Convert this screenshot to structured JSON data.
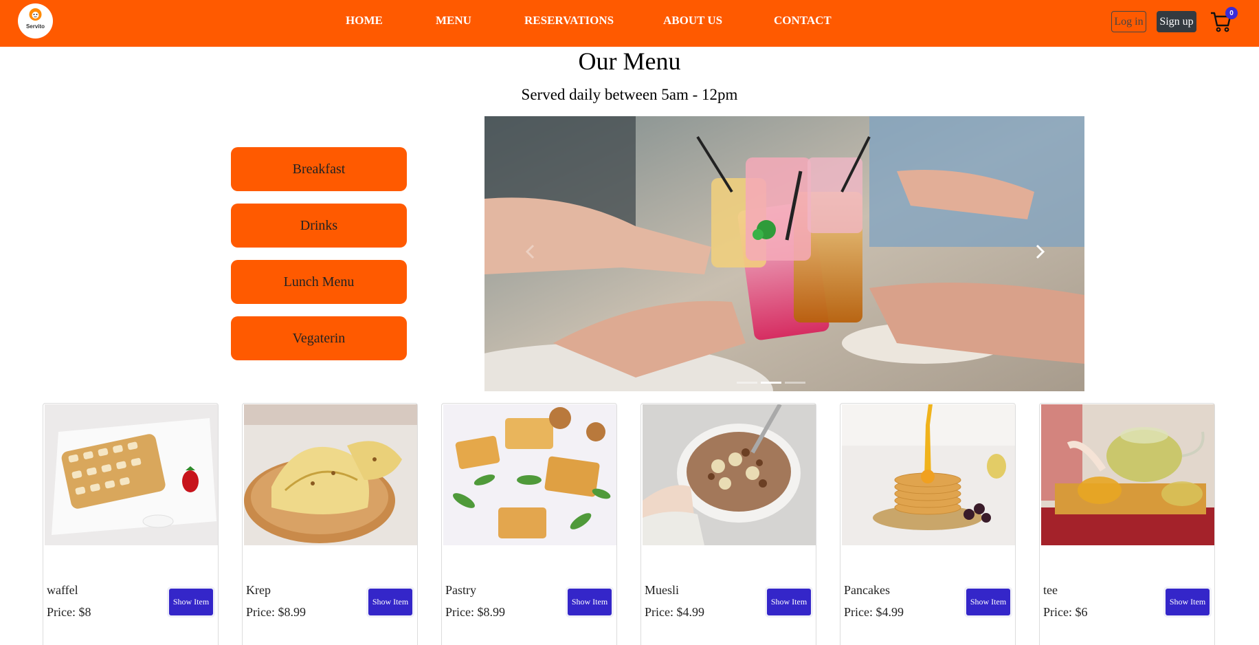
{
  "navbar": {
    "logo_text": "Servito",
    "links": [
      "HOME",
      "MENU",
      "RESERVATIONS",
      "ABOUT US",
      "CONTACT"
    ],
    "login_label": "Log in",
    "signup_label": "Sign up",
    "cart_count": "0",
    "colors": {
      "bar": "#ff5a00",
      "badge": "#3a2bd8"
    }
  },
  "menu": {
    "title": "Our Menu",
    "subtitle": "Served daily between 5am - 12pm"
  },
  "categories": [
    "Breakfast",
    "Drinks",
    "Lunch Menu",
    "Vegaterin"
  ],
  "carousel": {
    "image": "drinks-toast-photo",
    "prev_icon": "chevron-left-icon",
    "next_icon": "chevron-right-icon",
    "slide_count": 3,
    "active_slide": 2
  },
  "items": [
    {
      "name": "waffel",
      "price": "Price: $8",
      "button": "Show Item",
      "image": "waffle-photo"
    },
    {
      "name": "Krep",
      "price": "Price: $8.99",
      "button": "Show Item",
      "image": "crepe-photo"
    },
    {
      "name": "Pastry",
      "price": "Price: $8.99",
      "button": "Show Item",
      "image": "pastry-photo"
    },
    {
      "name": "Muesli",
      "price": "Price: $4.99",
      "button": "Show Item",
      "image": "muesli-photo"
    },
    {
      "name": "Pancakes",
      "price": "Price: $4.99",
      "button": "Show Item",
      "image": "pancakes-photo"
    },
    {
      "name": "tee",
      "price": "Price: $6",
      "button": "Show Item",
      "image": "tea-photo"
    }
  ],
  "theme": {
    "accent": "#ff5a00",
    "button": "#3426c9"
  }
}
